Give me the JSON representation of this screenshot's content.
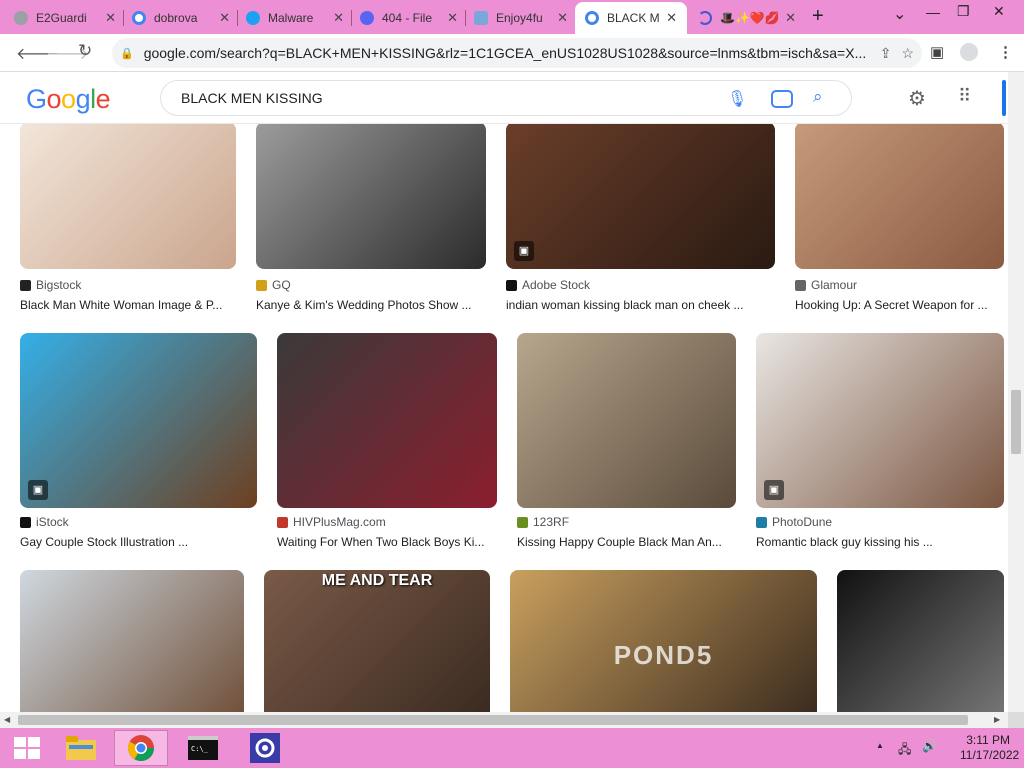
{
  "tabs": [
    {
      "title": "E2Guardi",
      "color": "#9aa0a6"
    },
    {
      "title": "dobrova",
      "color": "#4285f4"
    },
    {
      "title": "Malware",
      "color": "#1da1f2"
    },
    {
      "title": "404 - File",
      "color": "#5865f2"
    },
    {
      "title": "Enjoy4fu",
      "color": "#7aa7d9"
    },
    {
      "title": "BLACK M",
      "color": "#4285f4"
    },
    {
      "title": "🎩✨❤️💋",
      "color": "#3c5ad6"
    }
  ],
  "tab_close": "✕",
  "new_tab": "+",
  "window_controls": {
    "dropdown": "⌄",
    "minimize": "—",
    "restore": "❐",
    "close": "✕"
  },
  "url": "google.com/search?q=BLACK+MEN+KISSING&rlz=1C1GCEA_enUS1028US1028&source=lnms&tbm=isch&sa=X...",
  "logo": "Google",
  "search_query": "BLACK MEN KISSING",
  "results": [
    {
      "source": "Bigstock",
      "title": "Black Man White Woman Image & P...",
      "fav_color": "#222",
      "img": [
        "#f3e6da",
        "#caa58d"
      ],
      "badge": false
    },
    {
      "source": "GQ",
      "title": "Kanye & Kim's Wedding Photos Show ...",
      "fav_color": "#d4a017",
      "img": [
        "#9c9c9c",
        "#2b2b2b"
      ],
      "badge": false
    },
    {
      "source": "Adobe Stock",
      "title": "indian woman kissing black man on cheek ...",
      "fav_color": "#111",
      "img": [
        "#6b3e2a",
        "#2a1a12"
      ],
      "badge": true
    },
    {
      "source": "Glamour",
      "title": "Hooking Up: A Secret Weapon for ...",
      "fav_color": "#666",
      "img": [
        "#c79a7c",
        "#8a5a40"
      ],
      "badge": false
    },
    {
      "source": "iStock",
      "title": "Gay Couple Stock Illustration ...",
      "fav_color": "#111",
      "img": [
        "#34b0e8",
        "#6e3f1f"
      ],
      "badge": true
    },
    {
      "source": "HIVPlusMag.com",
      "title": "Waiting For When Two Black Boys Ki...",
      "fav_color": "#c0392b",
      "img": [
        "#3a3a3a",
        "#8b1e2e"
      ],
      "badge": false
    },
    {
      "source": "123RF",
      "title": "Kissing Happy Couple Black Man An...",
      "fav_color": "#6b8e23",
      "img": [
        "#b7a78e",
        "#5a4a3a"
      ],
      "badge": false
    },
    {
      "source": "PhotoDune",
      "title": "Romantic black guy kissing his ...",
      "fav_color": "#1e7fa6",
      "img": [
        "#e9e6e3",
        "#7a5540"
      ],
      "badge": true
    },
    {
      "source": "",
      "title": "",
      "fav_color": "#fff",
      "img": [
        "#cfd8e0",
        "#6f4e37"
      ],
      "badge": false
    },
    {
      "source": "",
      "title": "",
      "fav_color": "#fff",
      "img": [
        "#7a5a48",
        "#3a2a20"
      ],
      "caption": "ME AND TEAR",
      "badge": false
    },
    {
      "source": "",
      "title": "",
      "fav_color": "#fff",
      "img": [
        "#c9a05e",
        "#3a2a1e"
      ],
      "caption": "POND5",
      "badge": false
    },
    {
      "source": "",
      "title": "",
      "fav_color": "#fff",
      "img": [
        "#111111",
        "#777777"
      ],
      "badge": false
    }
  ],
  "tray": {
    "time": "3:11 PM",
    "date": "11/17/2022",
    "up": "▲"
  },
  "colors": {
    "chrome_pink": "#ec8fd4",
    "google_blue": "#4285f4"
  }
}
